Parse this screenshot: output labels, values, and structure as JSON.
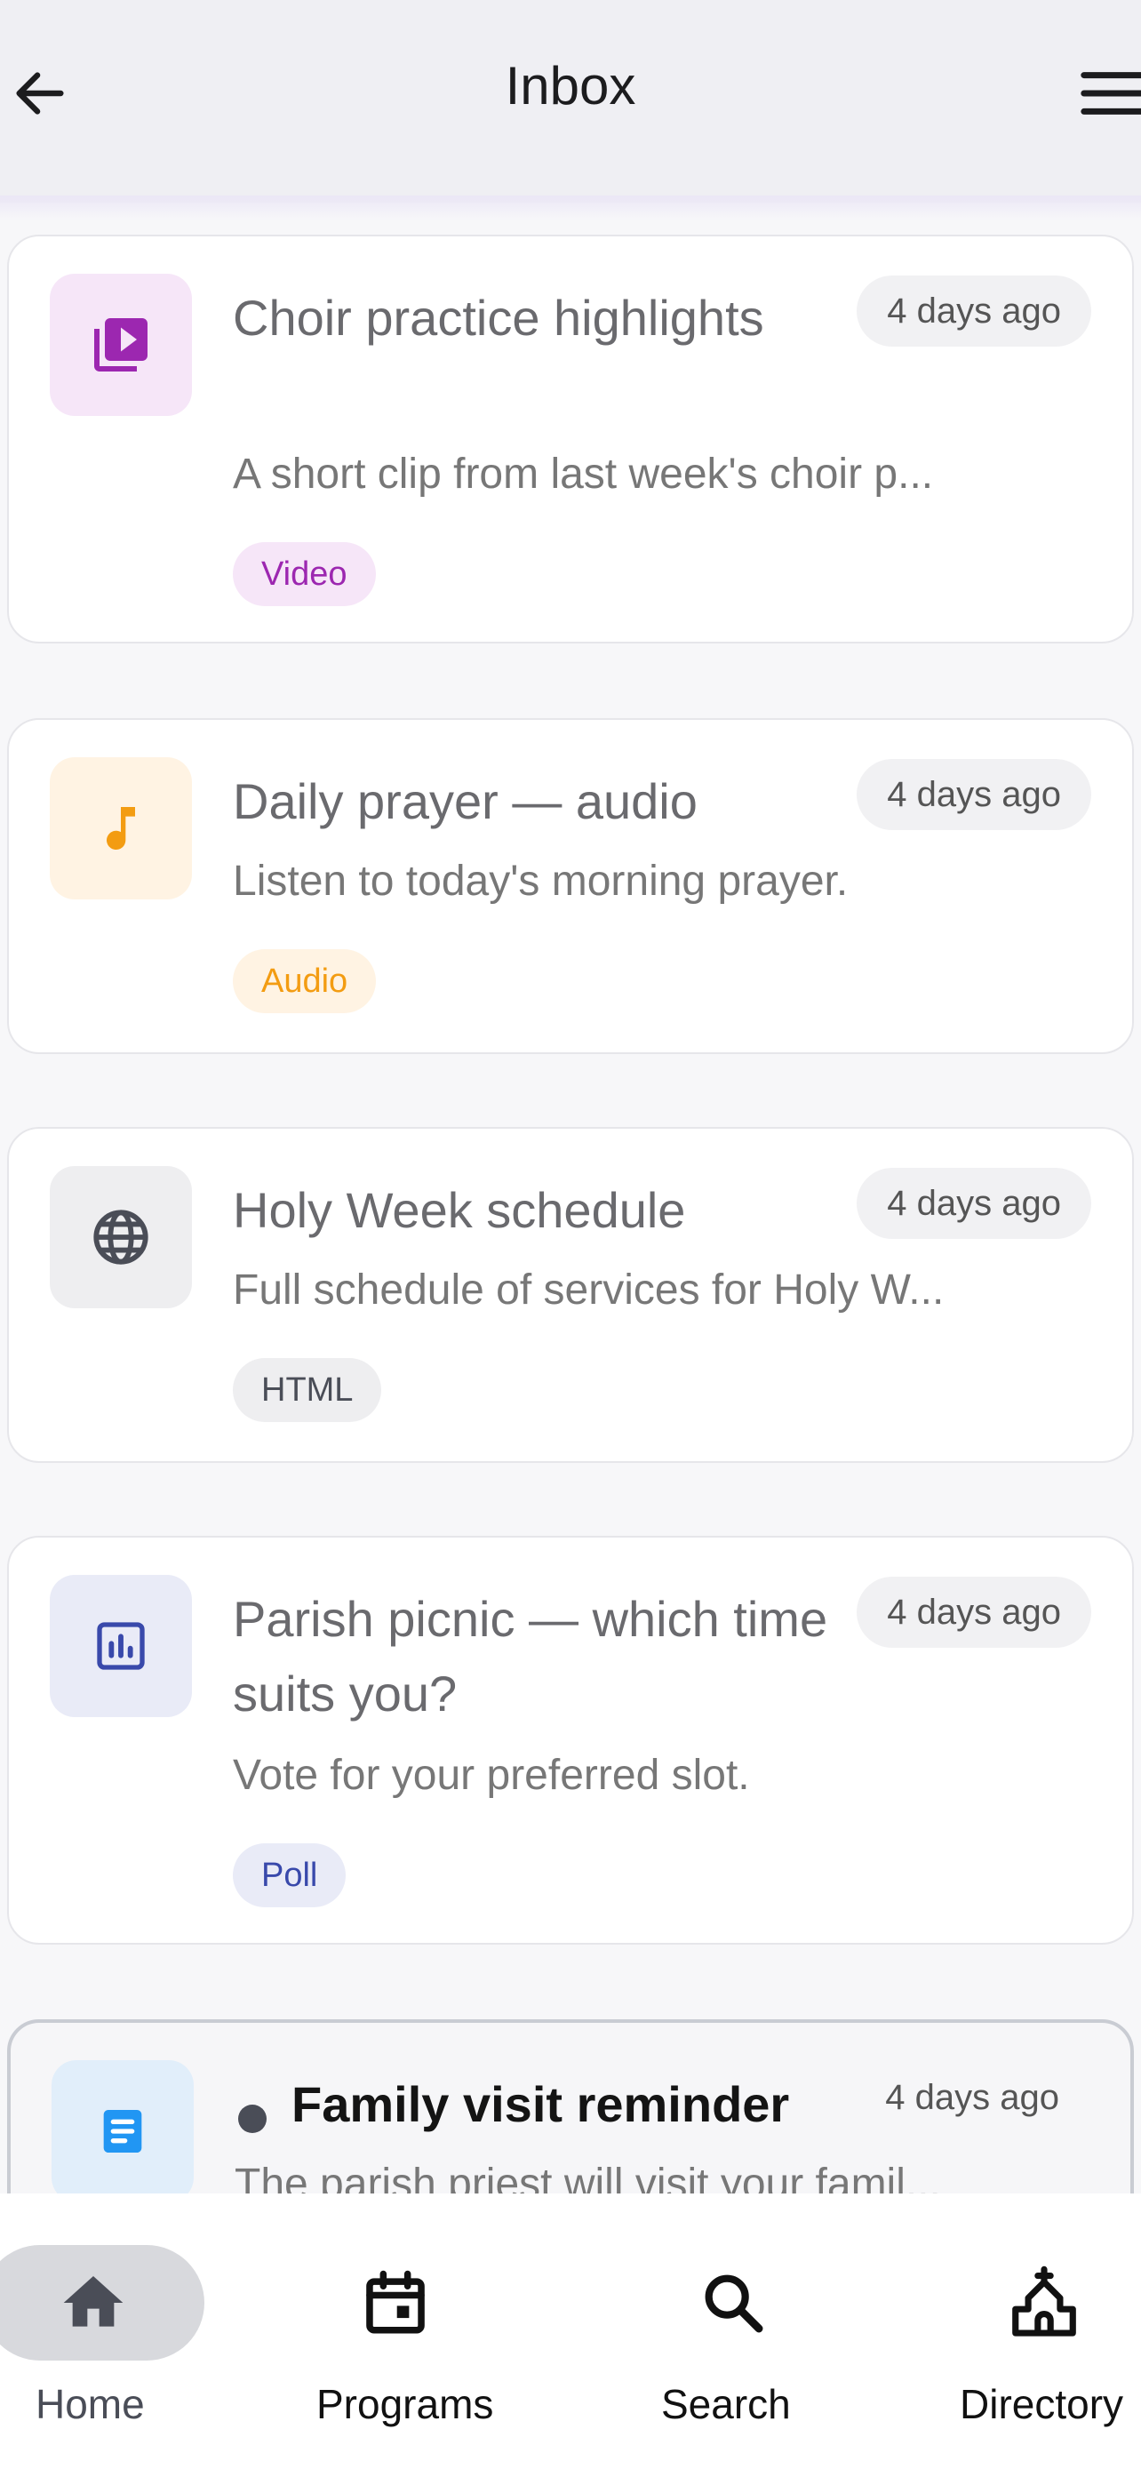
{
  "header": {
    "title": "Inbox",
    "back_icon": "arrow-left-icon",
    "menu_icon": "hamburger-menu-icon"
  },
  "messages": [
    {
      "title": "Choir practice highlights",
      "time": "4 days ago",
      "snippet": "A short clip from last week's choir p...",
      "badge": "Video",
      "icon": "video-library-icon",
      "accent": "#9c27b0",
      "icon_bg": "#f6e6f8",
      "badge_bg": "#f6e6f8",
      "unread": false
    },
    {
      "title": "Daily prayer — audio",
      "time": "4 days ago",
      "snippet": "Listen to today's morning prayer.",
      "badge": "Audio",
      "icon": "music-note-icon",
      "accent": "#f39c12",
      "icon_bg": "#fff3e3",
      "badge_bg": "#fff3e3",
      "unread": false
    },
    {
      "title": "Holy Week schedule",
      "time": "4 days ago",
      "snippet": "Full schedule of services for Holy W...",
      "badge": "HTML",
      "icon": "globe-icon",
      "accent": "#4a4d57",
      "icon_bg": "#eeeef0",
      "badge_bg": "#eeeef0",
      "unread": false
    },
    {
      "title": "Parish picnic — which time suits you?",
      "time": "4 days ago",
      "snippet": "Vote for your preferred slot.",
      "badge": "Poll",
      "icon": "poll-chart-icon",
      "accent": "#3949ab",
      "icon_bg": "#e9ebf7",
      "badge_bg": "#e9ebf7",
      "unread": false
    },
    {
      "title": "Family visit reminder",
      "time": "4 days ago",
      "snippet": "The parish priest will visit your famil...",
      "icon": "document-icon",
      "accent": "#2196f3",
      "icon_bg": "#e1eefa",
      "unread": true
    }
  ],
  "bottom_nav": [
    {
      "label": "Home",
      "icon": "home-icon",
      "active": true
    },
    {
      "label": "Programs",
      "icon": "calendar-icon",
      "active": false
    },
    {
      "label": "Search",
      "icon": "search-icon",
      "active": false
    },
    {
      "label": "Directory",
      "icon": "church-icon",
      "active": false
    }
  ]
}
